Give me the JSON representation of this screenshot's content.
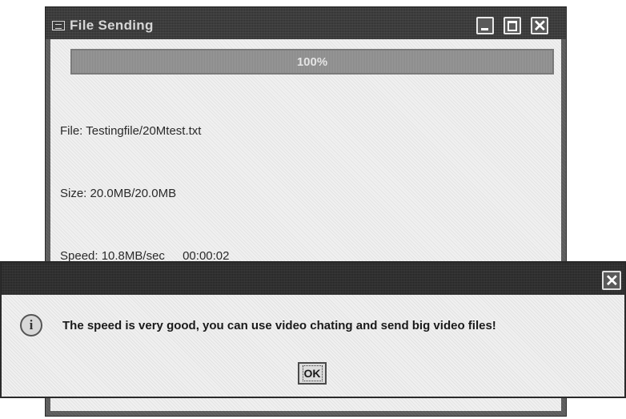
{
  "main_window": {
    "title": "File Sending",
    "progress": {
      "percent_text": "100%",
      "fraction": 1.0
    },
    "file_line": "File: Testingfile/20Mtest.txt",
    "size_line": "Size: 20.0MB/20.0MB",
    "speed_line": "Speed: 10.8MB/sec",
    "elapsed_time": "00:00:02",
    "title_icons": [
      "window-icon",
      "minimize-icon",
      "maximize-icon",
      "close-icon"
    ]
  },
  "message_dialog": {
    "title": "",
    "icon": "info-icon",
    "message": "The speed is very good, you can use video chating and send big video files!",
    "ok_label": "OK"
  }
}
